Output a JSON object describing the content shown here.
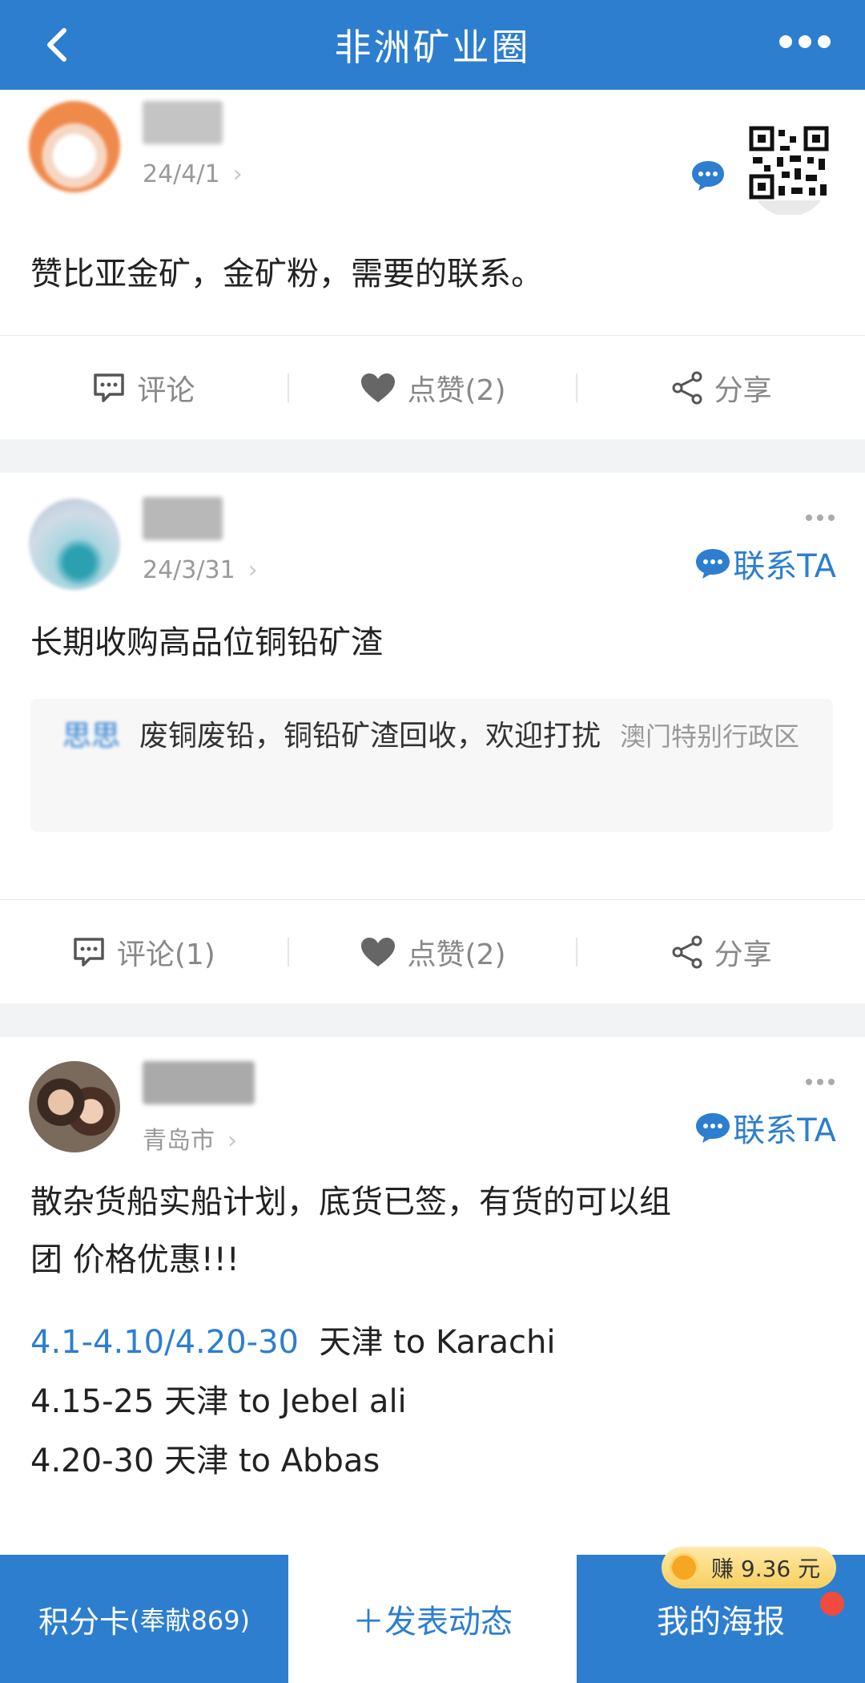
{
  "header": {
    "title": "非洲矿业圈"
  },
  "posts": [
    {
      "meta": "24/4/1",
      "content": "赞比亚金矿，金矿粉，需要的联系。",
      "actions": {
        "comment": "评论",
        "like": "点赞(2)",
        "share": "分享"
      }
    },
    {
      "meta": "24/3/31",
      "contact": "联系TA",
      "content": "长期收购高品位铜铅矿渣",
      "quote": {
        "name": "思思",
        "text": "废铜废铅，铜铅矿渣回收，欢迎打扰",
        "location": "澳门特别行政区"
      },
      "actions": {
        "comment": "评论(1)",
        "like": "点赞(2)",
        "share": "分享"
      }
    },
    {
      "meta": "青岛市",
      "contact": "联系TA",
      "content_line1": "散杂货船实船计划，底货已签，有货的可以组",
      "content_line2": "团 价格优惠!!!",
      "route1_date": "4.1-4.10/4.20-30",
      "route1_text": "  天津 to Karachi",
      "route2": "4.15-25 天津 to Jebel ali",
      "route3": "4.20-30  天津 to Abbas"
    }
  ],
  "bottom": {
    "left_label": "积分卡",
    "left_sub": "(奉献869)",
    "mid_label": "＋发表动态",
    "right_label": "我的海报",
    "earn": "赚 9.36 元"
  },
  "colors": {
    "primary": "#2d7ecf",
    "background": "#f2f3f5"
  }
}
